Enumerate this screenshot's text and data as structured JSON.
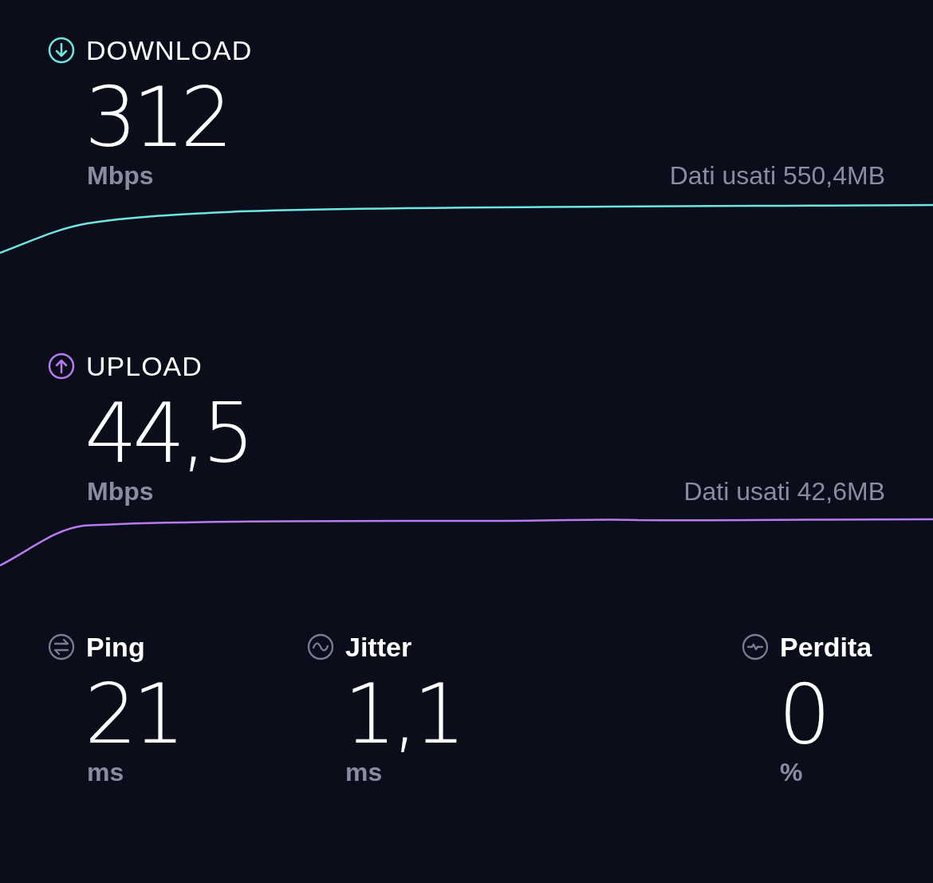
{
  "speeds": [
    {
      "kind": "download",
      "label": "DOWNLOAD",
      "color": "#6ee7e0",
      "value": "312",
      "unit": "Mbps",
      "data_used": "Dati usati 550,4MB"
    },
    {
      "kind": "upload",
      "label": "UPLOAD",
      "color": "#b77af0",
      "value": "44,5",
      "unit": "Mbps",
      "data_used": "Dati usati 42,6MB"
    }
  ],
  "stats": [
    {
      "kind": "ping",
      "label": "Ping",
      "value": "21",
      "unit": "ms"
    },
    {
      "kind": "jitter",
      "label": "Jitter",
      "value": "1,1",
      "unit": "ms"
    },
    {
      "kind": "loss",
      "label": "Perdita",
      "value": "0",
      "unit": "%"
    }
  ]
}
